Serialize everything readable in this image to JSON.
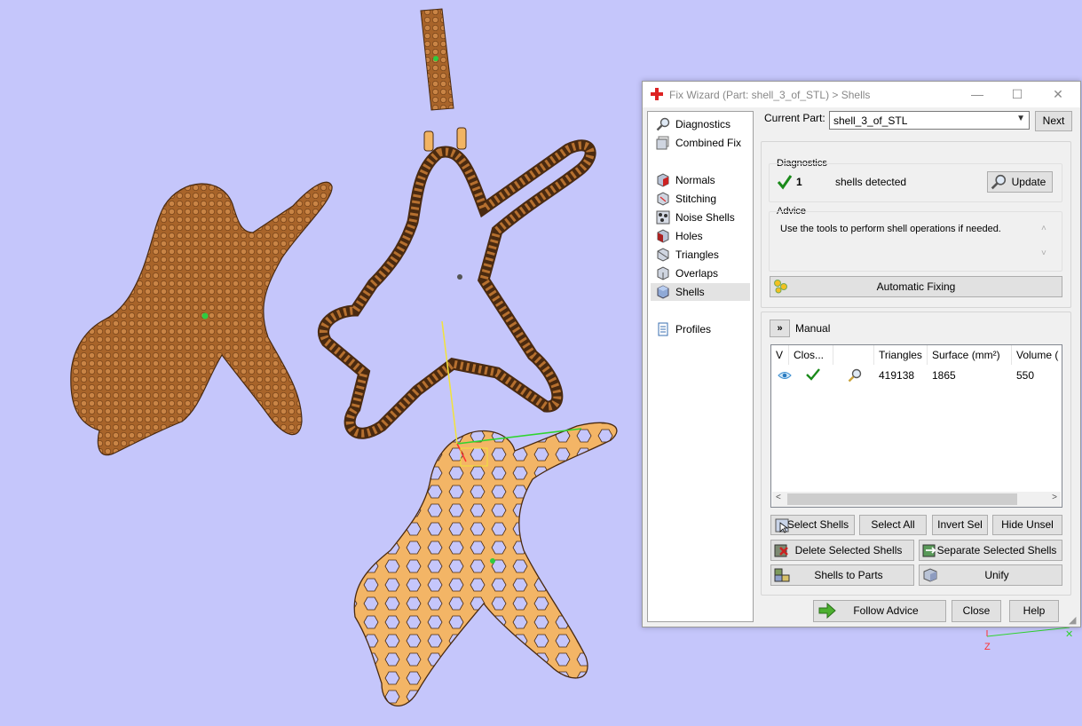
{
  "window": {
    "title": "Fix Wizard (Part: shell_3_of_STL) > Shells"
  },
  "nav": {
    "items": [
      {
        "label": "Diagnostics",
        "icon": "magnifier-icon"
      },
      {
        "label": "Combined Fix",
        "icon": "combined-fix-icon"
      },
      {
        "label": "Normals",
        "icon": "normals-cube-icon"
      },
      {
        "label": "Stitching",
        "icon": "stitching-cube-icon"
      },
      {
        "label": "Noise Shells",
        "icon": "noise-shells-icon"
      },
      {
        "label": "Holes",
        "icon": "holes-cube-icon"
      },
      {
        "label": "Triangles",
        "icon": "triangles-cube-icon"
      },
      {
        "label": "Overlaps",
        "icon": "overlaps-cube-icon"
      },
      {
        "label": "Shells",
        "icon": "shells-cube-icon"
      },
      {
        "label": "Profiles",
        "icon": "document-icon"
      }
    ],
    "selected": "Shells"
  },
  "part": {
    "label": "Current Part:",
    "value": "shell_3_of_STL",
    "next": "Next"
  },
  "diagnostics": {
    "title": "Diagnostics",
    "count": "1",
    "text": "shells detected",
    "update": "Update"
  },
  "advice": {
    "title": "Advice",
    "text": "Use the tools to perform shell operations if needed."
  },
  "auto_fix": "Automatic Fixing",
  "manual": {
    "title": "Manual",
    "columns": [
      "V",
      "Clos...",
      "",
      "Triangles",
      "Surface (mm²)",
      "Volume ("
    ],
    "rows": [
      {
        "triangles": "419138",
        "surface": "1865",
        "volume": "550"
      }
    ],
    "buttons": {
      "select_shells": "Select Shells",
      "select_all": "Select All",
      "invert_sel": "Invert Sel",
      "hide_unsel": "Hide Unsel",
      "delete_selected": "Delete Selected Shells",
      "separate_selected": "Separate Selected Shells",
      "shells_to_parts": "Shells to Parts",
      "unify": "Unify"
    }
  },
  "footer": {
    "follow_advice": "Follow Advice",
    "close": "Close",
    "help": "Help"
  },
  "axis": {
    "z_label": "Z"
  },
  "colors": {
    "background": "#c5c6fb",
    "part_fill": "#f2b463",
    "part_dark": "#a96426",
    "check_green": "#1a8a1a"
  }
}
